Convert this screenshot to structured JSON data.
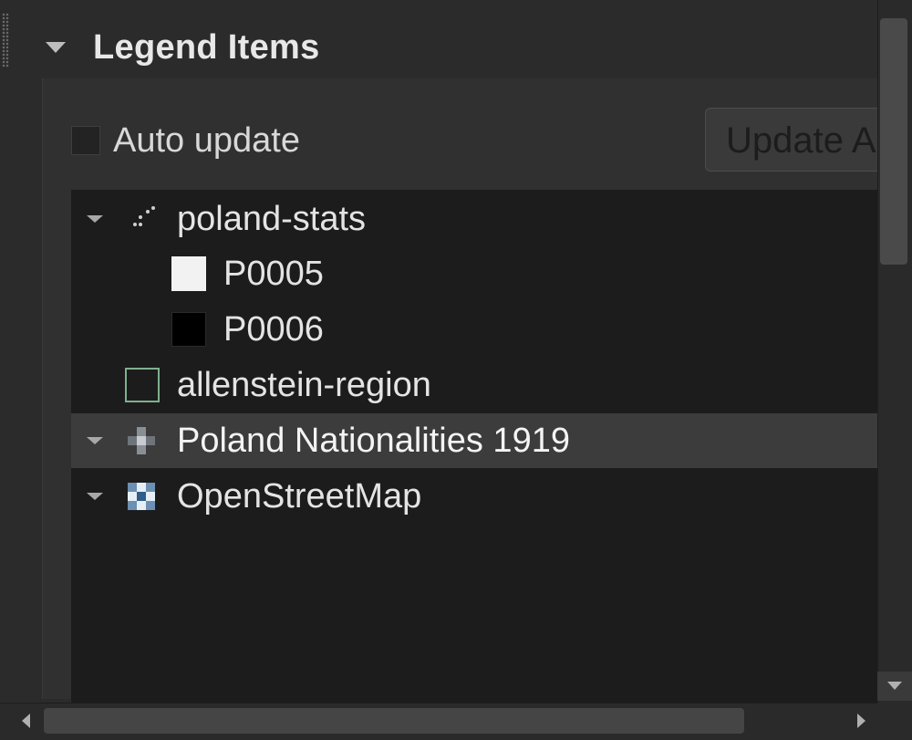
{
  "section": {
    "title": "Legend Items",
    "collapse_icon": "triangle-down-icon"
  },
  "auto_update": {
    "label": "Auto update",
    "checked": false
  },
  "update_button": {
    "label": "Update All"
  },
  "tree": {
    "items": [
      {
        "label": "poland-stats",
        "icon": "point-layer-icon",
        "expanded": true,
        "children": [
          {
            "label": "P0005",
            "swatch_color": "#f2f2f2"
          },
          {
            "label": "P0006",
            "swatch_color": "#000000"
          }
        ]
      },
      {
        "label": "allenstein-region",
        "icon": "polygon-outline-icon",
        "swatch_border": "#7fb08f"
      },
      {
        "label": "Poland Nationalities 1919",
        "icon": "raster-layer-icon",
        "expanded": false,
        "selected": true
      },
      {
        "label": "OpenStreetMap",
        "icon": "raster-layer-icon",
        "expanded": false
      }
    ]
  },
  "colors": {
    "background": "#2b2b2b",
    "tree_background": "#1c1c1c",
    "selected_row": "#3c3c3c",
    "text": "#e4e4e4"
  }
}
